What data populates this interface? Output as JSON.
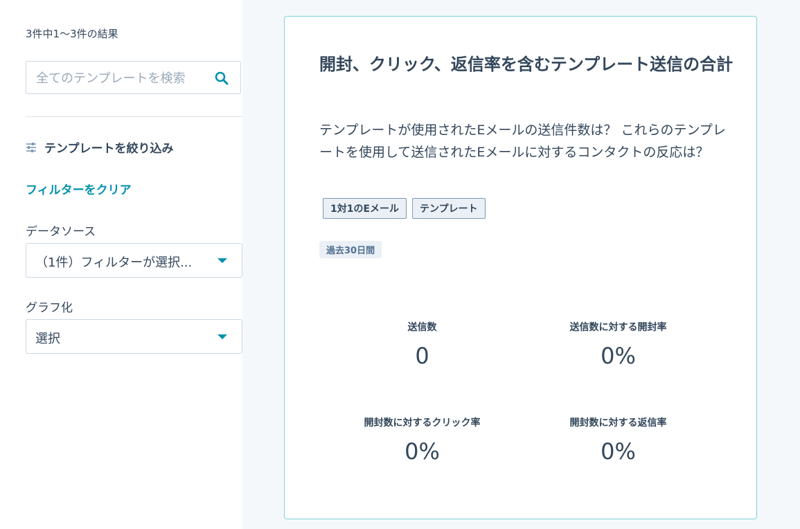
{
  "sidebar": {
    "results_count": "3件中1～3件の結果",
    "search": {
      "placeholder": "全てのテンプレートを検索",
      "value": ""
    },
    "filter_heading": "テンプレートを絞り込み",
    "clear_filter": "フィルターをクリア",
    "data_source": {
      "label": "データソース",
      "value": "（1件）フィルターが選択..."
    },
    "graph": {
      "label": "グラフ化",
      "value": "選択"
    }
  },
  "card": {
    "title": "開封、クリック、返信率を含むテンプレート送信の合計",
    "description": "テンプレートが使用されたEメールの送信件数は？ これらのテンプレートを使用して送信されたEメールに対するコンタクトの反応は？",
    "tags": [
      "1対1のEメール",
      "テンプレート"
    ],
    "period": "過去30日間",
    "metrics": [
      {
        "label": "送信数",
        "value": "0"
      },
      {
        "label": "送信数に対する開封率",
        "value": "0%"
      },
      {
        "label": "開封数に対するクリック率",
        "value": "0%"
      },
      {
        "label": "開封数に対する返信率",
        "value": "0%"
      }
    ]
  },
  "colors": {
    "accent": "#0091ae",
    "text": "#33475b",
    "card_border": "#7fd1de",
    "background": "#f5f8fa"
  },
  "icons": [
    "search-icon",
    "sliders-icon",
    "caret-down-icon"
  ]
}
